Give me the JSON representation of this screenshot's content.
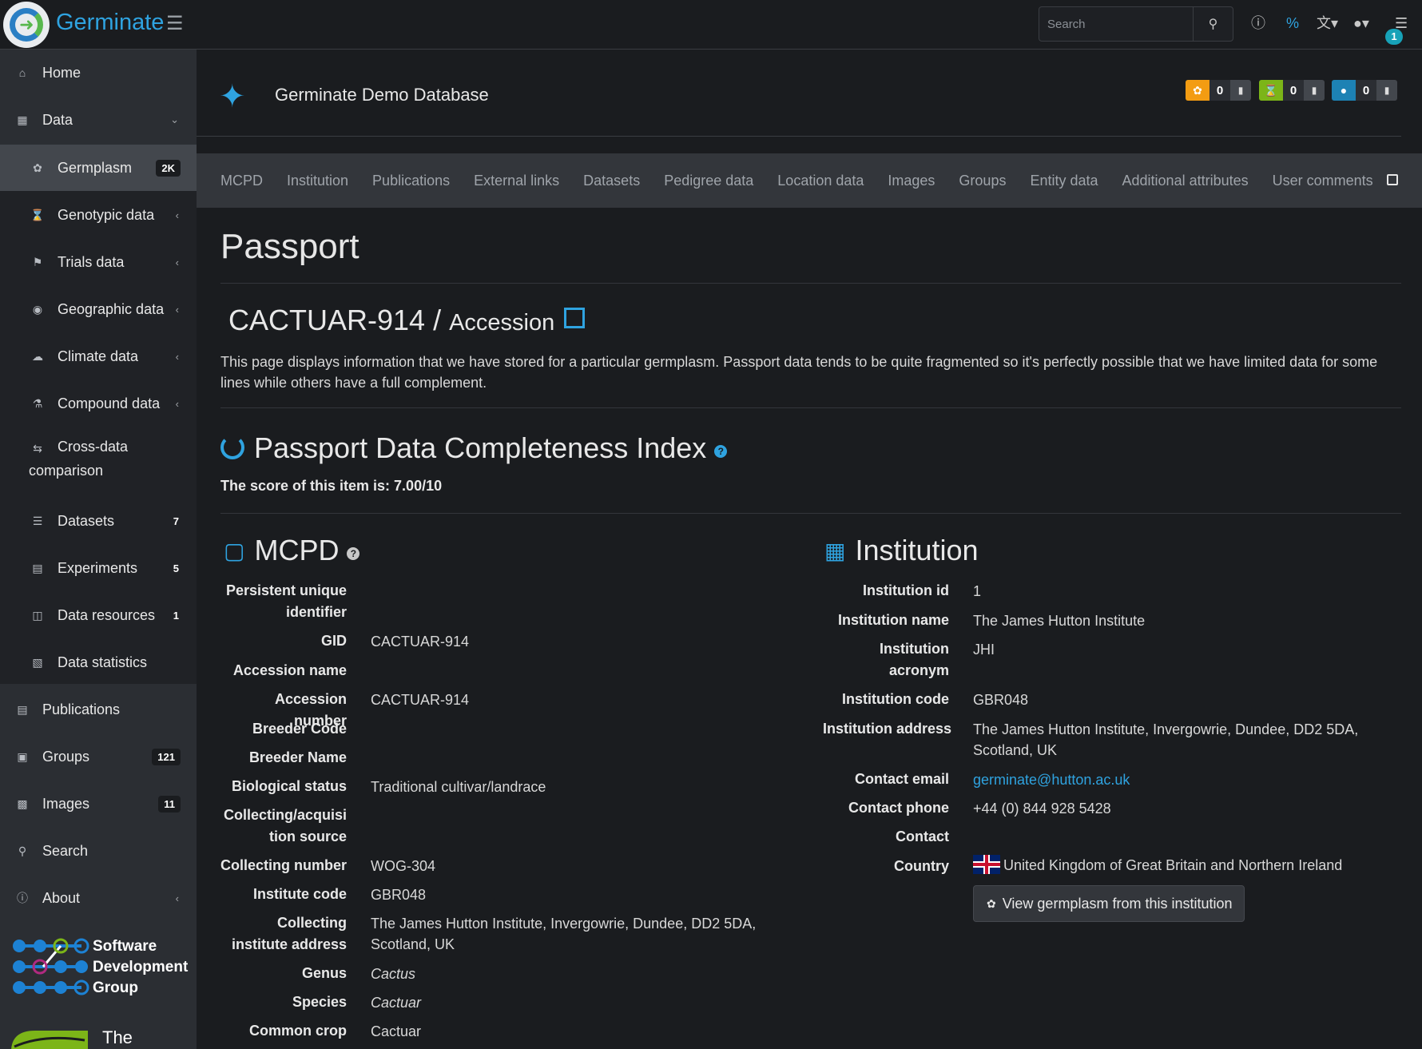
{
  "topbar": {
    "brand": "Germinate",
    "search_placeholder": "Search",
    "notification_count": "1"
  },
  "sidebar": {
    "items": [
      {
        "label": "Home",
        "icon": "home-icon",
        "level": "top"
      },
      {
        "label": "Data",
        "icon": "database-icon",
        "level": "top",
        "expanded": true
      },
      {
        "label": "Germplasm",
        "icon": "seedling-icon",
        "level": "sub",
        "count": "2K",
        "active": true
      },
      {
        "label": "Genotypic data",
        "icon": "hourglass-icon",
        "level": "sub"
      },
      {
        "label": "Trials data",
        "icon": "tag-icon",
        "level": "sub"
      },
      {
        "label": "Geographic data",
        "icon": "globe-icon",
        "level": "sub"
      },
      {
        "label": "Climate data",
        "icon": "cloud-icon",
        "level": "sub"
      },
      {
        "label": "Compound data",
        "icon": "flask-icon",
        "level": "sub"
      },
      {
        "label": "Cross-data",
        "label2": "comparison",
        "icon": "compare-icon",
        "level": "sub"
      },
      {
        "label": "Datasets",
        "icon": "stack-icon",
        "level": "sub",
        "count": "7"
      },
      {
        "label": "Experiments",
        "icon": "folder-icon",
        "level": "sub",
        "count": "5"
      },
      {
        "label": "Data resources",
        "icon": "file-icon",
        "level": "sub",
        "count": "1"
      },
      {
        "label": "Data statistics",
        "icon": "chart-icon",
        "level": "sub"
      },
      {
        "label": "Publications",
        "icon": "newspaper-icon",
        "level": "top"
      },
      {
        "label": "Groups",
        "icon": "group-icon",
        "level": "top",
        "count": "121"
      },
      {
        "label": "Images",
        "icon": "image-icon",
        "level": "top",
        "count": "11"
      },
      {
        "label": "Search",
        "icon": "search-icon",
        "level": "top"
      },
      {
        "label": "About",
        "icon": "info-icon",
        "level": "top"
      }
    ],
    "sdg_text": [
      "Software",
      "Development",
      "Group"
    ],
    "hutton_text": "The James"
  },
  "header": {
    "db_title": "Germinate Demo Database",
    "marked": [
      {
        "icon": "seedling-icon",
        "count": "0",
        "color": "#f39c12"
      },
      {
        "icon": "hourglass-icon",
        "count": "0",
        "color": "#7cb518"
      },
      {
        "icon": "map-pin-icon",
        "count": "0",
        "color": "#1d82b4"
      }
    ]
  },
  "tabs": [
    "MCPD",
    "Institution",
    "Publications",
    "External links",
    "Datasets",
    "Pedigree data",
    "Location data",
    "Images",
    "Groups",
    "Entity data",
    "Additional attributes",
    "User comments"
  ],
  "passport": {
    "title": "Passport",
    "accession_name": "CACTUAR-914",
    "accession_type": "Accession",
    "intro": "This page displays information that we have stored for a particular germplasm. Passport data tends to be quite fragmented so it's perfectly possible that we have limited data for some lines while others have a full complement.",
    "pdci_title": "Passport Data Completeness Index",
    "score_text": "The score of this item is: 7.00/10"
  },
  "mcpd": {
    "title": "MCPD",
    "rows": [
      {
        "label": "Persistent unique identifier",
        "value": ""
      },
      {
        "label": "GID",
        "value": "CACTUAR-914"
      },
      {
        "label": "Accession name",
        "value": ""
      },
      {
        "label": "Accession number",
        "value": "CACTUAR-914"
      },
      {
        "label": "Breeder Code",
        "value": ""
      },
      {
        "label": "Breeder Name",
        "value": ""
      },
      {
        "label": "Biological status",
        "value": "Traditional cultivar/landrace"
      },
      {
        "label": "Collecting/acquisition source",
        "value": ""
      },
      {
        "label": "Collecting number",
        "value": "WOG-304"
      },
      {
        "label": "Institute code",
        "value": "GBR048"
      },
      {
        "label": "Collecting institute address",
        "value": "The James Hutton Institute, Invergowrie, Dundee, DD2 5DA, Scotland, UK"
      },
      {
        "label": "Genus",
        "value": "Cactus"
      },
      {
        "label": "Species",
        "value": "Cactuar"
      },
      {
        "label": "Common crop",
        "value": "Cactuar"
      }
    ]
  },
  "institution": {
    "title": "Institution",
    "rows": [
      {
        "label": "Institution id",
        "value": "1"
      },
      {
        "label": "Institution name",
        "value": "The James Hutton Institute"
      },
      {
        "label": "Institution acronym",
        "value": "JHI"
      },
      {
        "label": "Institution code",
        "value": "GBR048"
      },
      {
        "label": "Institution address",
        "value": "The James Hutton Institute, Invergowrie, Dundee, DD2 5DA, Scotland, UK"
      },
      {
        "label": "Contact email",
        "value": "germinate@hutton.ac.uk"
      },
      {
        "label": "Contact phone",
        "value": "+44 (0) 844 928 5428"
      },
      {
        "label": "Contact",
        "value": ""
      },
      {
        "label": "Country",
        "value": "United Kingdom of Great Britain and Northern Ireland"
      }
    ],
    "button_label": "View germplasm from this institution"
  }
}
